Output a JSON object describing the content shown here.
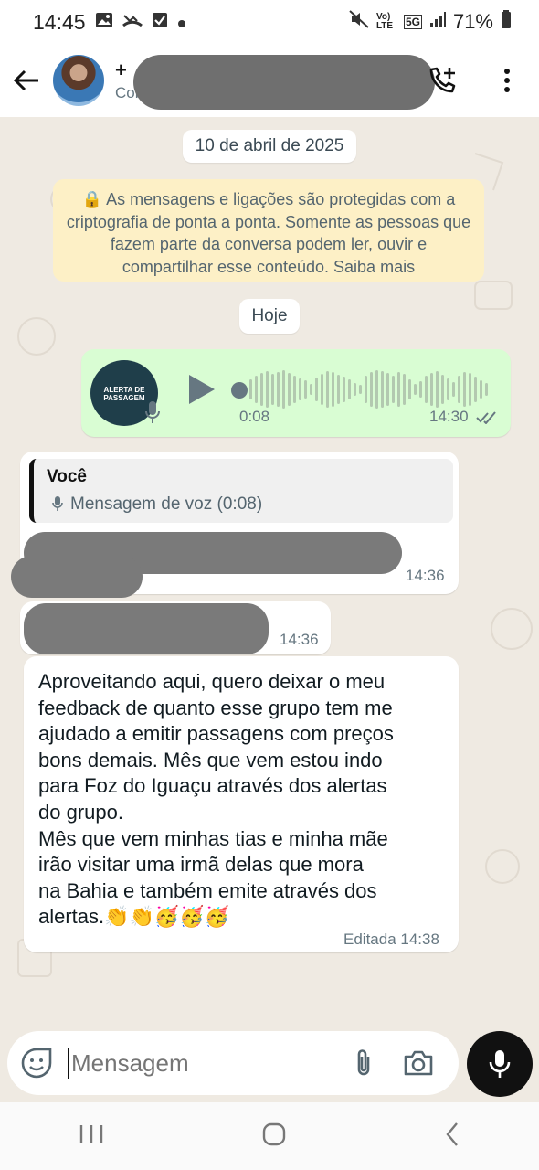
{
  "status": {
    "time": "14:45",
    "battery": "71%",
    "network": "5G",
    "volte": "Vo) LTE",
    "left_icons": [
      "gallery-icon",
      "missed-call-icon",
      "checkbox-icon",
      "dot-icon"
    ],
    "right_icons": [
      "mute-icon",
      "volte-icon",
      "5g-icon",
      "signal-icon",
      "battery-icon"
    ]
  },
  "header": {
    "name_prefix": "+",
    "subtitle": "Conta"
  },
  "chat": {
    "date_pill": "10 de abril de 2025",
    "encryption_notice": "🔒 As mensagens e ligações são protegidas com a criptografia de ponta a ponta. Somente as pessoas que fazem parte da conversa podem ler, ouvir e compartilhar esse conteúdo. Saiba mais",
    "today_pill": "Hoje",
    "voice_message": {
      "thumb_label": "ALERTA DE PASSAGEM",
      "duration": "0:08",
      "time": "14:30",
      "status": "read"
    },
    "reply": {
      "quoted_author": "Você",
      "quoted_text": "Mensagem de voz (0:08)",
      "time": "14:36"
    },
    "msg2_time": "14:36",
    "feedback": {
      "text": "Aproveitando aqui, quero deixar o meu\nfeedback de quanto esse grupo tem me\najudado a emitir passagens com preços\nbons demais. Mês que vem estou indo\npara Foz do Iguaçu através dos alertas\ndo grupo.\nMês que vem minhas tias e minha mãe\nirão visitar uma irmã delas que mora\nna Bahia e também emite através dos\nalertas.👏👏🥳🥳🥳",
      "edited_label": "Editada 14:38"
    }
  },
  "composer": {
    "placeholder": "Mensagem"
  }
}
